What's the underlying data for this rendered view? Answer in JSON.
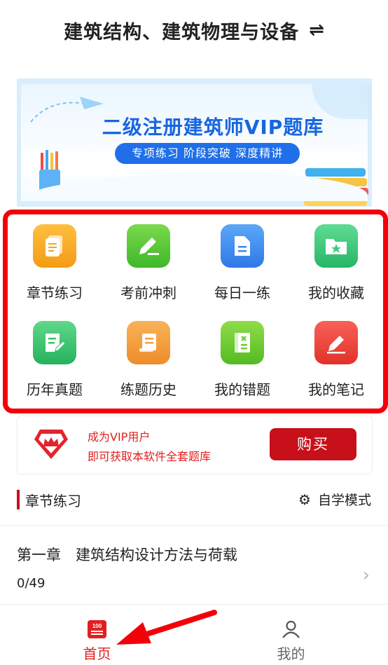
{
  "header": {
    "title": "建筑结构、建筑物理与设备",
    "switch_icon": "⇌"
  },
  "banner": {
    "title": "二级注册建筑师VIP题库",
    "subtitle": "专项练习 阶段突破 深度精讲"
  },
  "grid": [
    {
      "label": "章节练习",
      "icon": "document-icon",
      "color": "#f6a623"
    },
    {
      "label": "考前冲刺",
      "icon": "pen-icon",
      "color": "#5fcc3a"
    },
    {
      "label": "每日一练",
      "icon": "file-icon",
      "color": "#3a8bef"
    },
    {
      "label": "我的收藏",
      "icon": "folder-star-icon",
      "color": "#3ccc7c"
    },
    {
      "label": "历年真题",
      "icon": "paper-pen-icon",
      "color": "#33c46a"
    },
    {
      "label": "练题历史",
      "icon": "scroll-icon",
      "color": "#f2a03a"
    },
    {
      "label": "我的错题",
      "icon": "error-book-icon",
      "color": "#6fcf34"
    },
    {
      "label": "我的笔记",
      "icon": "note-pen-icon",
      "color": "#ef4137"
    }
  ],
  "vip": {
    "line1": "成为VIP用户",
    "line2": "即可获取本软件全套题库",
    "button": "购买"
  },
  "section": {
    "title": "章节练习",
    "mode": "自学模式"
  },
  "chapter": {
    "title": "第一章　建筑结构设计方法与荷载",
    "progress": "0/49"
  },
  "tabs": [
    {
      "label": "首页",
      "color": "#e02020",
      "icon_text": "100"
    },
    {
      "label": "我的",
      "color": "#666666"
    }
  ]
}
